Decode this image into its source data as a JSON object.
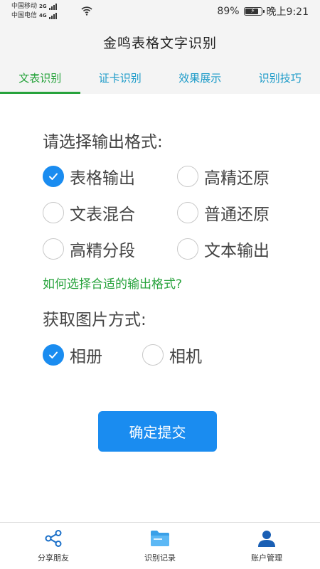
{
  "status_bar": {
    "carrier1": "中国移动",
    "carrier1_net": "2G",
    "carrier2": "中国电信",
    "carrier2_net": "4G",
    "battery": "89%",
    "time": "晚上9:21"
  },
  "header": {
    "title": "金鸣表格文字识别"
  },
  "tabs": [
    {
      "label": "文表识别",
      "active": true
    },
    {
      "label": "证卡识别",
      "active": false
    },
    {
      "label": "效果展示",
      "active": false
    },
    {
      "label": "识别技巧",
      "active": false
    }
  ],
  "output_format": {
    "title": "请选择输出格式:",
    "options": [
      {
        "label": "表格输出",
        "checked": true
      },
      {
        "label": "高精还原",
        "checked": false
      },
      {
        "label": "文表混合",
        "checked": false
      },
      {
        "label": "普通还原",
        "checked": false
      },
      {
        "label": "高精分段",
        "checked": false
      },
      {
        "label": "文本输出",
        "checked": false
      }
    ],
    "help_link": "如何选择合适的输出格式?"
  },
  "image_source": {
    "title": "获取图片方式:",
    "options": [
      {
        "label": "相册",
        "checked": true
      },
      {
        "label": "相机",
        "checked": false
      }
    ]
  },
  "submit_label": "确定提交",
  "bottom_nav": [
    {
      "label": "分享朋友",
      "icon": "share-icon"
    },
    {
      "label": "识别记录",
      "icon": "folder-icon"
    },
    {
      "label": "账户管理",
      "icon": "user-icon"
    }
  ],
  "colors": {
    "accent_blue": "#1a8cf0",
    "tab_blue": "#1a9ac8",
    "active_green": "#27a33c"
  }
}
